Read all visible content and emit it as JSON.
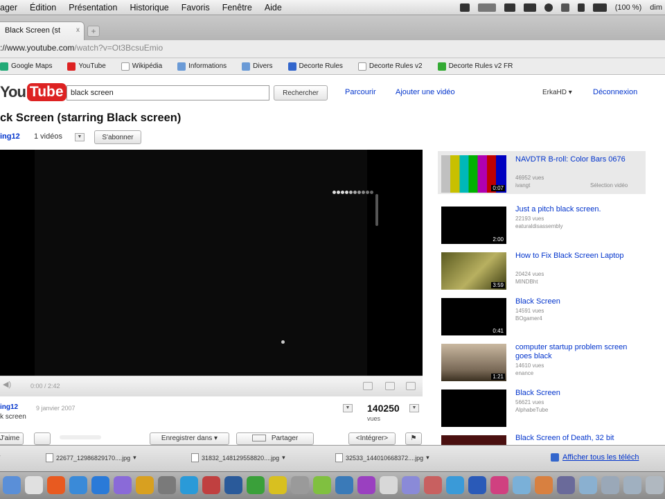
{
  "menubar": {
    "items": [
      "ager",
      "Édition",
      "Présentation",
      "Historique",
      "Favoris",
      "Fenêtre",
      "Aide"
    ],
    "status_clock": "(100 %)",
    "status_user": "dim"
  },
  "tab": {
    "title": "Black Screen (st",
    "close": "x"
  },
  "address": {
    "host": "://www.youtube.com",
    "path": "/watch?v=Ot3BcsuEmio"
  },
  "bookmarks": [
    {
      "label": "Google Maps",
      "color": "#2a7"
    },
    {
      "label": "YouTube",
      "color": "#d22"
    },
    {
      "label": "Wikipédia",
      "color": "#666"
    },
    {
      "label": "Informations",
      "color": "#6a9ad6"
    },
    {
      "label": "Divers",
      "color": "#6a9ad6"
    },
    {
      "label": "Decorte Rules",
      "color": "#36c"
    },
    {
      "label": "Decorte Rules v2",
      "color": "#fff"
    },
    {
      "label": "Decorte Rules v2 FR",
      "color": "#3a3"
    }
  ],
  "logo": {
    "you": "You",
    "tube": "Tube"
  },
  "search": {
    "value": "black screen",
    "button": "Rechercher"
  },
  "nav": {
    "browse": "Parcourir",
    "upload": "Ajouter une vidéo",
    "user": "ErkaHD",
    "logout": "Déconnexion"
  },
  "video": {
    "title": "ck Screen (starring Black screen)",
    "channel": "ing12",
    "video_count": "1 vidéos",
    "subscribe": "S'abonner",
    "time": "0:00 / 2:42",
    "uploader": "ing12",
    "date": "9 janvier 2007",
    "subline": "k screen",
    "views": "140250",
    "views_label": "vues",
    "actions": {
      "like": "J'aime",
      "save": "Enregistrer dans",
      "share": "Partager",
      "embed": "<Intégrer>"
    }
  },
  "sidebar": [
    {
      "title": "NAVDTR B-roll: Color Bars 0676",
      "views": "46952 vues",
      "author": "ivangt",
      "extra": "Sélection vidéo",
      "duration": "0:07"
    },
    {
      "title": "Just a pitch black screen.",
      "views": "22193 vues",
      "author": "eaturaldisassembly",
      "duration": "2:00"
    },
    {
      "title": "How to Fix Black Screen Laptop",
      "views": "20424 vues",
      "author": "MINDBht",
      "duration": "3:59"
    },
    {
      "title": "Black Screen",
      "views": "14591 vues",
      "author": "BOgamer4",
      "duration": "0:41"
    },
    {
      "title": "computer startup problem screen goes black",
      "views": "14610 vues",
      "author": "enance",
      "duration": "1:21"
    },
    {
      "title": "Black Screen",
      "views": "56621 vues",
      "author": "AlphabeTube",
      "duration": ""
    },
    {
      "title": "Black Screen of Death, 32 bit",
      "views": "",
      "author": "",
      "duration": ""
    }
  ],
  "downloads": [
    {
      "name": "22677_12986829170....jpg"
    },
    {
      "name": "31832_148129558820....jpg"
    },
    {
      "name": "32533_144010668372....jpg"
    }
  ],
  "downloads_show_all": "Afficher tous les téléch",
  "dock_colors": [
    "#5a8fd8",
    "#e0e0e0",
    "#e85a20",
    "#3a8ad8",
    "#2a7ad8",
    "#8a6ad8",
    "#d8a020",
    "#7a7a7a",
    "#2a9ad8",
    "#c04040",
    "#2a5a9a",
    "#3aa03a",
    "#d8c020",
    "#9a9a9a",
    "#80c040",
    "#3a7ab8",
    "#9a40c0",
    "#d8d8d8",
    "#8a8ad8",
    "#c86060",
    "#3a9ad8",
    "#2a5ab8",
    "#d04080",
    "#7ab0d8",
    "#d88040",
    "#6a6a9a",
    "#8ab0d0",
    "#9aa8b8",
    "#a0b0c0",
    "#b0b8c0"
  ]
}
